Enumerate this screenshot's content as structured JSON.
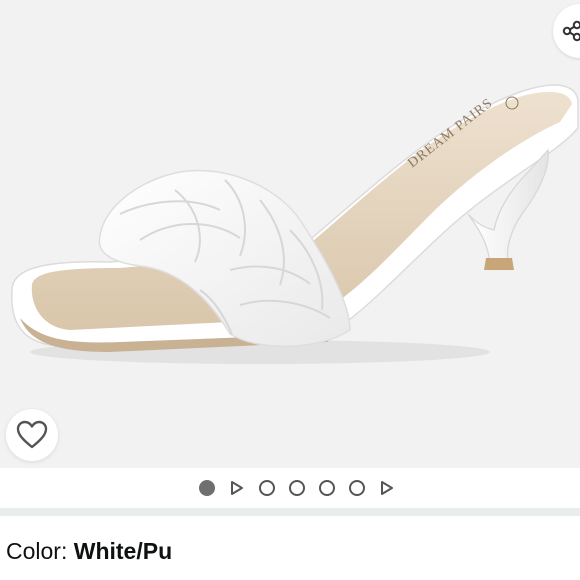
{
  "product": {
    "brand_imprint": "DREAM PAIRS",
    "alt": "White braided square toe kitten heel mule sandal"
  },
  "gallery": {
    "items": [
      {
        "type": "image",
        "active": true
      },
      {
        "type": "video",
        "active": false
      },
      {
        "type": "image",
        "active": false
      },
      {
        "type": "image",
        "active": false
      },
      {
        "type": "image",
        "active": false
      },
      {
        "type": "image",
        "active": false
      },
      {
        "type": "video",
        "active": false
      }
    ]
  },
  "icons": {
    "share": "share-icon",
    "wishlist": "heart-icon",
    "video": "play-triangle-icon"
  },
  "variation": {
    "label": "Color: ",
    "value": "White/Pu"
  },
  "colors": {
    "background": "#f2f2f2",
    "divider": "#eaeded",
    "text": "#0f1111"
  }
}
